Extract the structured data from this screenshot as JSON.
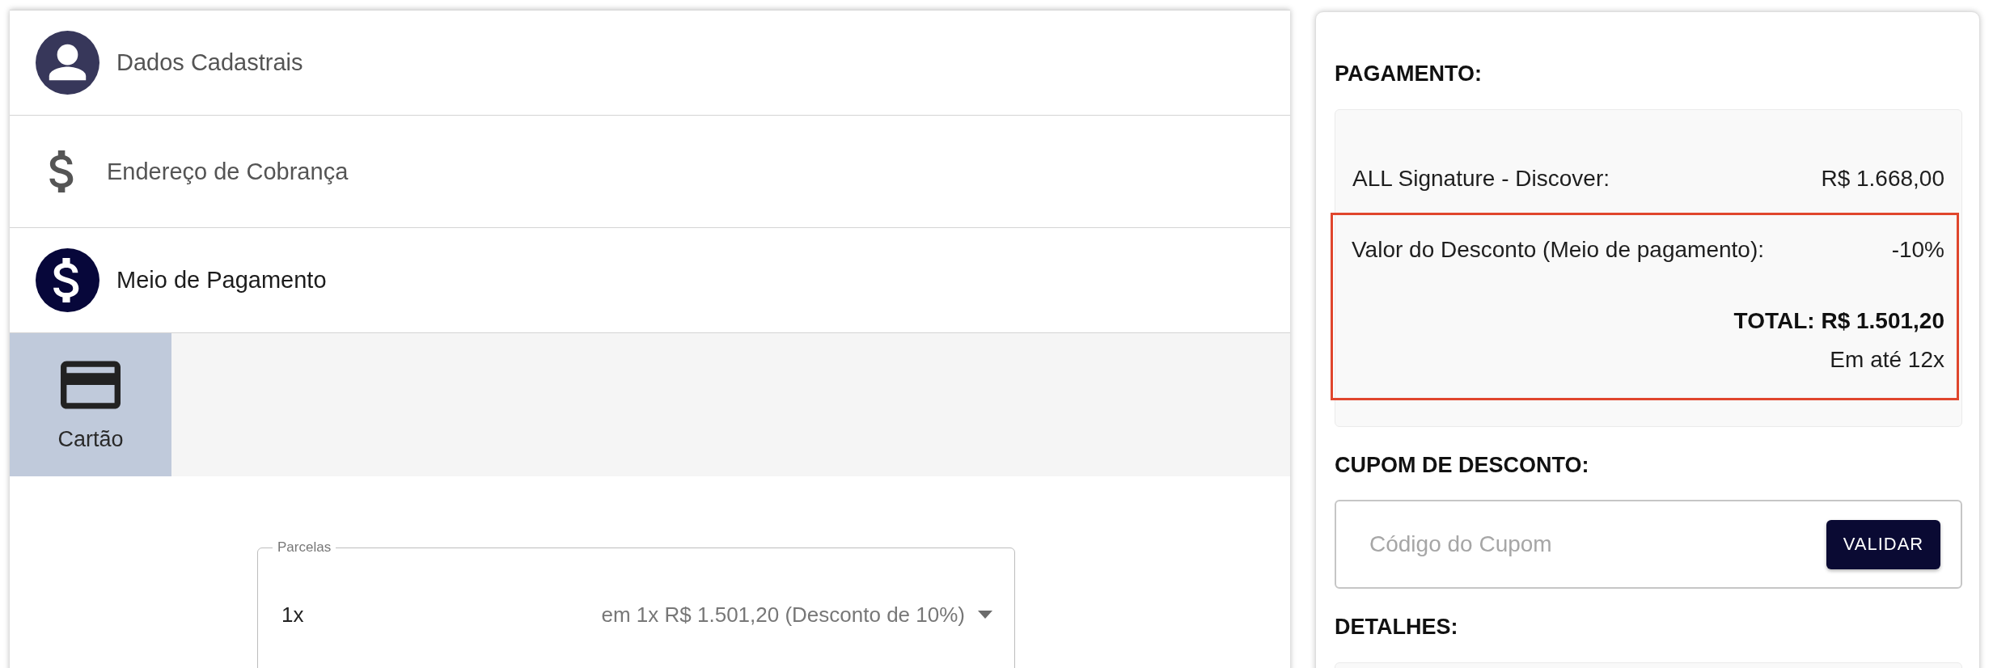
{
  "steps": [
    {
      "kind": "profile",
      "title": "Dados Cadastrais",
      "completed": true,
      "selected": false
    },
    {
      "kind": "billing",
      "title": "Endereço de Cobrança",
      "completed": false,
      "selected": false
    },
    {
      "kind": "payment",
      "title": "Meio de Pagamento",
      "completed": false,
      "selected": true
    }
  ],
  "payment_methods": [
    {
      "kind": "card",
      "label": "Cartão",
      "selected": true
    }
  ],
  "installments": {
    "label": "Parcelas",
    "value": "1x",
    "detail": "em 1x R$ 1.501,20 (Desconto de 10%)"
  },
  "summary": {
    "title": "PAGAMENTO:",
    "product": {
      "label": "ALL Signature - Discover:",
      "value": "R$ 1.668,00"
    },
    "highlighted": true,
    "discount": {
      "label": "Valor do Desconto (Meio de pagamento):",
      "value": "-10%"
    },
    "total": "TOTAL: R$ 1.501,20",
    "installments": "Em até 12x"
  },
  "coupon": {
    "title": "CUPOM DE DESCONTO:",
    "placeholder": "Código do Cupom",
    "button": "VALIDAR"
  },
  "details": {
    "title": "DETALHES:"
  }
}
